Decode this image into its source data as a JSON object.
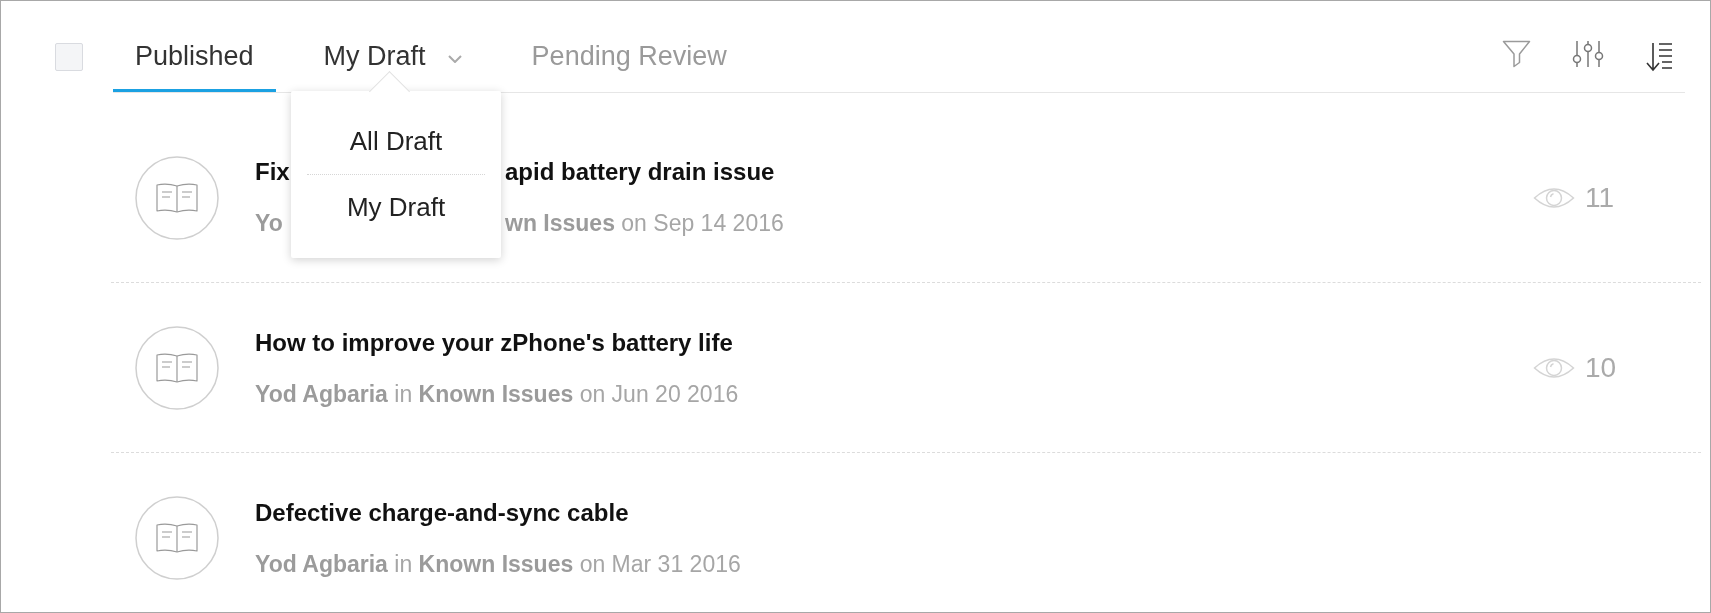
{
  "select_all": {
    "checked": false
  },
  "tabs": [
    {
      "label": "Published",
      "kind": "plain",
      "selected": true
    },
    {
      "label": "My Draft",
      "kind": "dropdown",
      "selected": false,
      "expanded": true,
      "menu": [
        {
          "label": "All Draft"
        },
        {
          "label": "My Draft"
        }
      ]
    },
    {
      "label": "Pending Review",
      "kind": "plain",
      "selected": false
    }
  ],
  "articles": [
    {
      "title": [
        "Fix",
        "apid battery drain issue"
      ],
      "meta": [
        "**Yo**",
        "**wn Issues** on Sep 14 2016"
      ],
      "views": "11"
    },
    {
      "title": [
        "How to improve your zPhone's battery life"
      ],
      "meta": [
        "**Yod Agbaria** in **Known Issues** on Jun 20 2016"
      ],
      "views": "10"
    },
    {
      "title": [
        "Defective charge-and-sync cable"
      ],
      "meta": [
        "**Yod Agbaria** in **Known Issues** on Mar 31 2016"
      ]
    }
  ]
}
